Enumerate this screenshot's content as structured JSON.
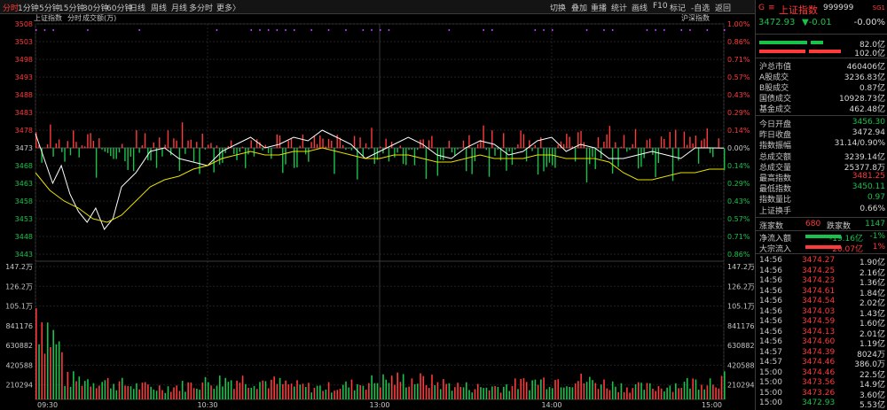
{
  "toolbar": {
    "left_items": [
      "分时",
      "1分钟",
      "5分钟",
      "15分钟",
      "30分钟",
      "60分钟",
      "日线",
      "周线",
      "月线",
      "多分时",
      "更多〉"
    ],
    "active_index": 0,
    "right_items": [
      "切换",
      "叠加",
      "重播",
      "统计",
      "画线",
      "F10",
      "标记",
      "-自选",
      "返回"
    ]
  },
  "chart_header": {
    "title": "上证指数",
    "mode": "分时",
    "volume_label": "成交额(万)",
    "compare_label": "沪深指数"
  },
  "chart_data": {
    "type": "line",
    "title": "上证指数",
    "prev_close": 3472.94,
    "y_price_ticks": [
      "3508",
      "3503",
      "3498",
      "3493",
      "3488",
      "3483",
      "3478",
      "3473",
      "3468",
      "3463",
      "3458",
      "3453",
      "3448",
      "3443"
    ],
    "y_pct_ticks": [
      "1.00%",
      "0.86%",
      "0.71%",
      "0.57%",
      "0.43%",
      "0.29%",
      "0.14%",
      "0.00%",
      "0.14%",
      "0.29%",
      "0.43%",
      "0.57%",
      "0.71%",
      "0.86%"
    ],
    "y_volume_ticks": [
      "147.2万",
      "126.2万",
      "105.1万",
      "841176",
      "630882",
      "420588",
      "210294"
    ],
    "volume_max": 1472000,
    "x_ticks": [
      "09:30",
      "10:30",
      "13:00",
      "14:00",
      "15:00"
    ],
    "series": [
      {
        "color": "#ffffff",
        "values_key": "price",
        "x": [
          0,
          3,
          6,
          9,
          12,
          15,
          18,
          21,
          24,
          27,
          30,
          35,
          40,
          45,
          50,
          55,
          60,
          65,
          70,
          75,
          80,
          85,
          90,
          95,
          100,
          105,
          110,
          115,
          120,
          125,
          130,
          135,
          140,
          145,
          150,
          155,
          160,
          165,
          170,
          175,
          180,
          185,
          190,
          195,
          200,
          205,
          210,
          215,
          220,
          225,
          230,
          235,
          240
        ],
        "values": [
          3477,
          3470,
          3463,
          3468,
          3460,
          3455,
          3452,
          3456,
          3450,
          3453,
          3462,
          3466,
          3472,
          3473,
          3470,
          3469,
          3468,
          3472,
          3474,
          3476,
          3473,
          3474,
          3476,
          3475,
          3478,
          3476,
          3474,
          3470,
          3472,
          3474,
          3476,
          3474,
          3471,
          3470,
          3473,
          3475,
          3474,
          3471,
          3472,
          3475,
          3476,
          3472,
          3474,
          3473,
          3470,
          3470,
          3471,
          3472,
          3471,
          3470,
          3473,
          3473,
          3472.93
        ]
      },
      {
        "color": "#e8e000",
        "values_key": "avg",
        "x": [
          0,
          5,
          10,
          15,
          20,
          25,
          30,
          35,
          40,
          45,
          50,
          55,
          60,
          65,
          70,
          75,
          80,
          85,
          90,
          95,
          100,
          105,
          110,
          115,
          120,
          125,
          130,
          135,
          140,
          145,
          150,
          155,
          160,
          165,
          170,
          175,
          180,
          185,
          190,
          195,
          200,
          205,
          210,
          215,
          220,
          225,
          230,
          235,
          240
        ],
        "values": [
          3466,
          3461,
          3458,
          3456,
          3453,
          3452,
          3454,
          3458,
          3462,
          3464,
          3465,
          3467,
          3468,
          3470,
          3471,
          3472,
          3471,
          3471,
          3472,
          3472,
          3473,
          3472,
          3471,
          3470,
          3470,
          3471,
          3471,
          3470,
          3469,
          3469,
          3470,
          3471,
          3470,
          3470,
          3470,
          3471,
          3471,
          3470,
          3470,
          3470,
          3469,
          3466,
          3464,
          3464,
          3465,
          3466,
          3466,
          3467,
          3467
        ]
      }
    ],
    "x_range": [
      0,
      240
    ],
    "y_range": [
      3443,
      3508
    ]
  },
  "quote": {
    "header_mark": "G",
    "header_mark2": "≡",
    "name": "上证指数",
    "code": "999999",
    "badge": "SG1",
    "price": "3472.93",
    "change": "▼-0.01",
    "change_pct": "-0.00%",
    "bar1_value": "82.0亿",
    "bar2_value": "102.0亿",
    "rows1": [
      {
        "label": "沪总市值",
        "value": "460406亿",
        "cls": "white"
      },
      {
        "label": "A股成交",
        "value": "3236.83亿",
        "cls": "white"
      },
      {
        "label": "B股成交",
        "value": "0.87亿",
        "cls": "white"
      },
      {
        "label": "国债成交",
        "value": "10928.73亿",
        "cls": "white"
      },
      {
        "label": "基金成交",
        "value": "462.48亿",
        "cls": "white"
      }
    ],
    "rows2": [
      {
        "label": "今日开盘",
        "value": "3456.30",
        "cls": "green"
      },
      {
        "label": "昨日收盘",
        "value": "3472.94",
        "cls": "white"
      },
      {
        "label": "指数振幅",
        "value": "31.14/0.90%",
        "cls": "white"
      },
      {
        "label": "总成交额",
        "value": "3239.14亿",
        "cls": "white"
      },
      {
        "label": "总成交量",
        "value": "25377.8万",
        "cls": "white"
      },
      {
        "label": "最高指数",
        "value": "3481.25",
        "cls": "red"
      },
      {
        "label": "最低指数",
        "value": "3450.11",
        "cls": "green"
      },
      {
        "label": "指数量比",
        "value": "0.97",
        "cls": "green"
      },
      {
        "label": "上证换手",
        "value": "0.66%",
        "cls": "white"
      }
    ],
    "rise_label": "涨家数",
    "rise_value": "680",
    "fall_label": "跌家数",
    "fall_value": "1147",
    "flow": [
      {
        "label": "净流入额",
        "amount": "-19.16亿",
        "pct": "-1%",
        "color": "#19c34b"
      },
      {
        "label": "大宗流入",
        "amount": "20.07亿",
        "pct": "1%",
        "color": "#ff3a3a"
      }
    ],
    "ticks": [
      {
        "time": "14:56",
        "price": "3474.27",
        "vol": "1.90亿"
      },
      {
        "time": "14:56",
        "price": "3474.25",
        "vol": "2.16亿"
      },
      {
        "time": "14:56",
        "price": "3474.23",
        "vol": "1.36亿"
      },
      {
        "time": "14:56",
        "price": "3474.61",
        "vol": "1.84亿"
      },
      {
        "time": "14:56",
        "price": "3474.54",
        "vol": "2.02亿"
      },
      {
        "time": "14:56",
        "price": "3474.03",
        "vol": "1.43亿"
      },
      {
        "time": "14:56",
        "price": "3474.59",
        "vol": "1.60亿"
      },
      {
        "time": "14:56",
        "price": "3474.13",
        "vol": "2.01亿"
      },
      {
        "time": "14:56",
        "price": "3474.60",
        "vol": "1.19亿"
      },
      {
        "time": "14:57",
        "price": "3474.39",
        "vol": "8024万"
      },
      {
        "time": "14:57",
        "price": "3474.46",
        "vol": "386.0万"
      },
      {
        "time": "15:00",
        "price": "3474.46",
        "vol": "22.5亿"
      },
      {
        "time": "15:00",
        "price": "3473.56",
        "vol": "14.9亿"
      },
      {
        "time": "15:00",
        "price": "3473.26",
        "vol": "3.60亿"
      },
      {
        "time": "15:00",
        "price": "3472.93",
        "vol": "5.53亿"
      }
    ]
  }
}
